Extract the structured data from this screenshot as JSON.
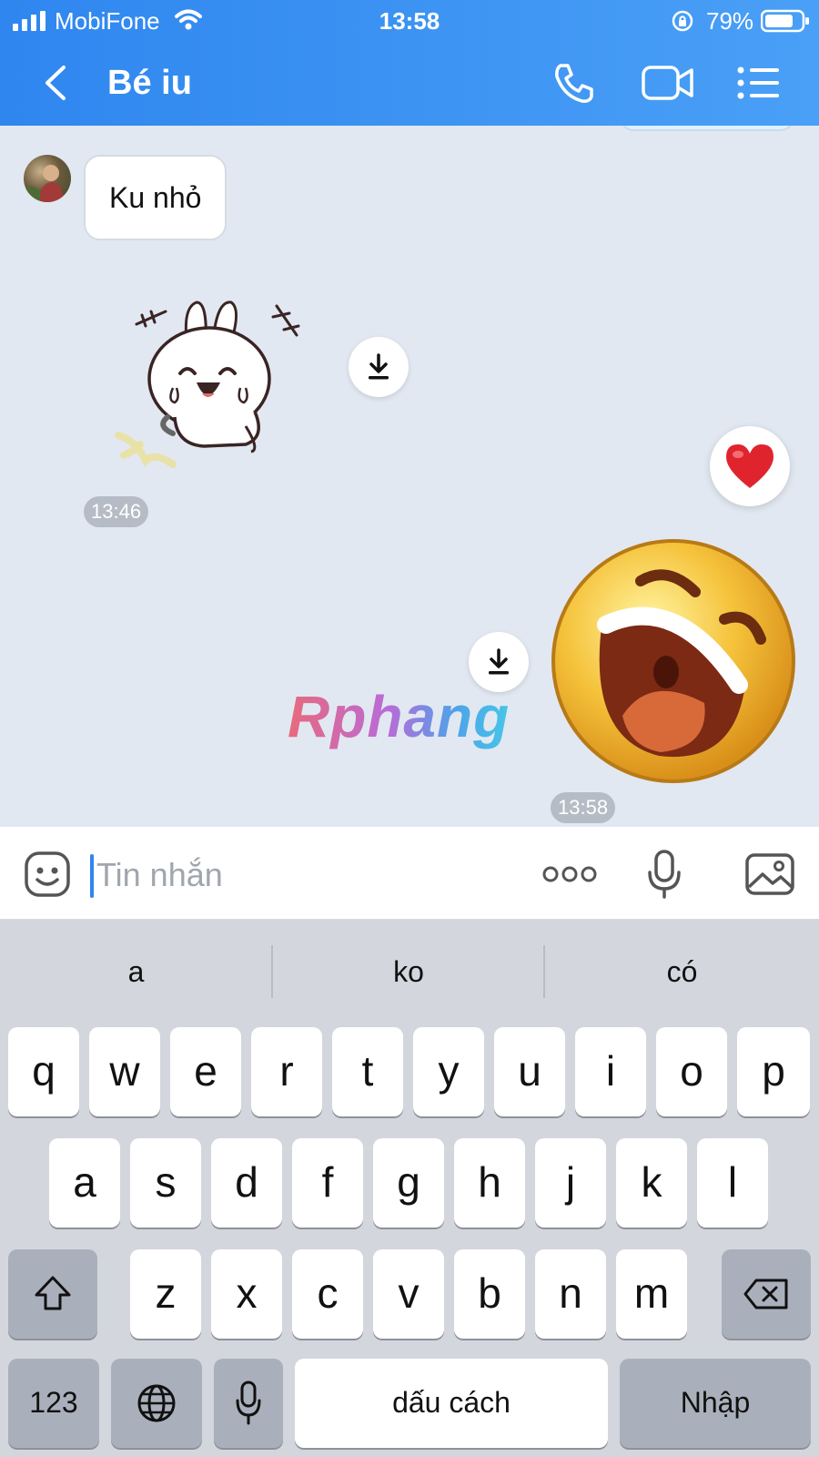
{
  "status_bar": {
    "carrier": "MobiFone",
    "time": "13:58",
    "battery": "79%"
  },
  "header": {
    "title": "Bé iu"
  },
  "chat": {
    "messages": [
      {
        "sender": "contact",
        "type": "text",
        "text": "Ku nhỏ"
      },
      {
        "sender": "contact",
        "type": "sticker",
        "sticker": "bunny-laughing-sticker",
        "time": "13:46"
      },
      {
        "sender": "me",
        "type": "sticker",
        "sticker": "laughing-emoji-sticker",
        "time": "13:58"
      }
    ],
    "reaction": "heart",
    "watermark": "Rphang"
  },
  "input": {
    "placeholder": "Tin nhắn"
  },
  "keyboard": {
    "suggestions": [
      "a",
      "ko",
      "có"
    ],
    "row1": [
      "q",
      "w",
      "e",
      "r",
      "t",
      "y",
      "u",
      "i",
      "o",
      "p"
    ],
    "row2": [
      "a",
      "s",
      "d",
      "f",
      "g",
      "h",
      "j",
      "k",
      "l"
    ],
    "row3": [
      "z",
      "x",
      "c",
      "v",
      "b",
      "n",
      "m"
    ],
    "numbers_label": "123",
    "space_label": "dấu cách",
    "return_label": "Nhập"
  },
  "colors": {
    "header_start": "#2f86ef",
    "header_end": "#4aa0f6",
    "chat_bg": "#e2e8f1",
    "accent": "#2f86ef"
  }
}
